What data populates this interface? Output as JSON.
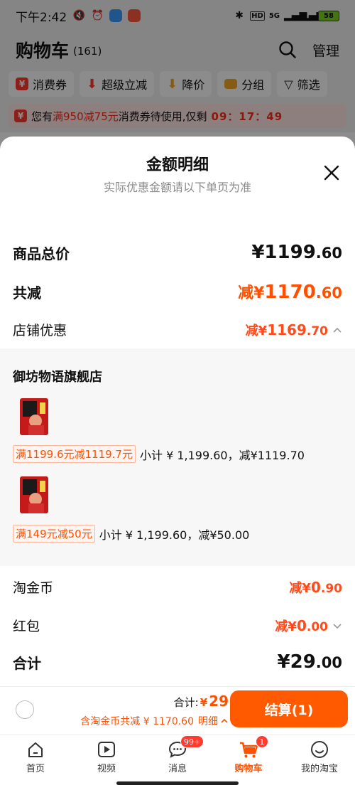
{
  "status_bar": {
    "time": "下午2:42",
    "network": "5G",
    "battery": "58"
  },
  "cart_header": {
    "title": "购物车",
    "count": "(161)",
    "manage_label": "管理"
  },
  "filter_bar": {
    "items": [
      {
        "label": "消费券",
        "icon": "coupon-icon"
      },
      {
        "label": "超级立减",
        "icon": "down-arrow-icon"
      },
      {
        "label": "降价",
        "icon": "price-drop-icon"
      },
      {
        "label": "分组",
        "icon": "folder-icon"
      },
      {
        "label": "筛选",
        "icon": "filter-icon"
      }
    ]
  },
  "coupon_banner": {
    "prefix": "您有",
    "highlight": "满950减75元",
    "suffix": "消费券待使用,仅剩",
    "timer": "09：17：49"
  },
  "sheet": {
    "title": "金额明细",
    "subtitle": "实际优惠金额请以下单页为准",
    "goods_total": {
      "label": "商品总价",
      "yen": "¥",
      "int": "1199",
      "dec": ".60"
    },
    "total_discount": {
      "label": "共减",
      "prefix": "减¥",
      "int": "1170",
      "dec": ".60"
    },
    "store_discount": {
      "label": "店铺优惠",
      "prefix": "减¥",
      "int": "1169",
      "dec": ".70"
    },
    "store": {
      "name": "御坊物语旗舰店",
      "items": [
        {
          "promo": "满1199.6元减1119.7元",
          "subtotal": "小计 ¥ 1,199.60，减¥1119.70"
        },
        {
          "promo": "满149元减50元",
          "subtotal": "小计 ¥ 1,199.60，减¥50.00"
        }
      ]
    },
    "taojinbi": {
      "label": "淘金币",
      "prefix": "减¥",
      "int": "0",
      "dec": ".90"
    },
    "hongbao": {
      "label": "红包",
      "prefix": "减¥",
      "int": "0",
      "dec": ".00"
    },
    "sum": {
      "label": "合计",
      "yen": "¥",
      "int": "29",
      "dec": ".00"
    }
  },
  "checkout": {
    "total_label": "合计:",
    "total_yen": "¥",
    "total_value": "29",
    "sub_text": "含淘金币共减 ¥ 1170.60",
    "detail_label": "明细",
    "settle_label": "结算(1)"
  },
  "tab_bar": {
    "tabs": [
      {
        "label": "首页",
        "icon": "home-icon"
      },
      {
        "label": "视频",
        "icon": "video-icon"
      },
      {
        "label": "消息",
        "icon": "message-icon",
        "badge": "99+"
      },
      {
        "label": "购物车",
        "icon": "cart-icon",
        "badge": "1",
        "active": true
      },
      {
        "label": "我的淘宝",
        "icon": "profile-icon"
      }
    ]
  },
  "colors": {
    "accent": "#ff5000",
    "settle_button": "#ff5a00",
    "badge": "#ff3b2f"
  }
}
